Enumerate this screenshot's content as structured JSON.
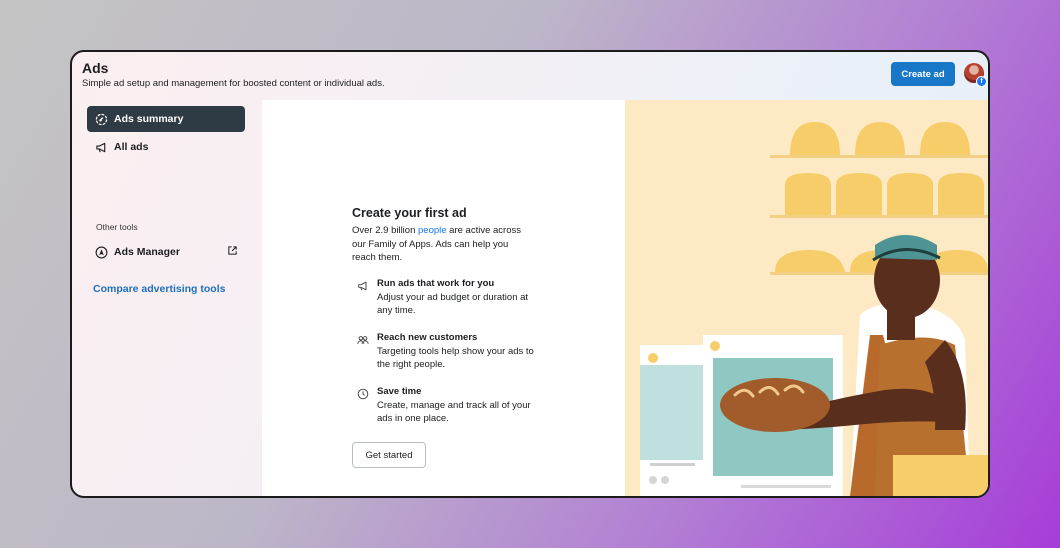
{
  "header": {
    "title": "Ads",
    "subtitle": "Simple ad setup and management for boosted content or individual ads.",
    "create_button": "Create ad"
  },
  "sidebar": {
    "items": [
      {
        "label": "Ads summary",
        "icon": "gauge-icon",
        "active": true
      },
      {
        "label": "All ads",
        "icon": "megaphone-icon",
        "active": false
      }
    ],
    "other_tools_label": "Other tools",
    "tools": [
      {
        "label": "Ads Manager",
        "icon": "navigation-arrow-icon",
        "external_icon": "external-link-icon"
      }
    ],
    "compare_link": "Compare advertising tools"
  },
  "main": {
    "title": "Create your first ad",
    "desc_before": "Over 2.9 billion ",
    "desc_link": "people",
    "desc_after": " are active across our Family of Apps. Ads can help you reach them.",
    "features": [
      {
        "title": "Run ads that work for you",
        "desc": "Adjust your ad budget or duration at any time.",
        "icon": "megaphone-icon"
      },
      {
        "title": "Reach new customers",
        "desc": "Targeting tools help show your ads to the right people.",
        "icon": "people-icon"
      },
      {
        "title": "Save time",
        "desc": "Create, manage and track all of your ads in one place.",
        "icon": "clock-icon"
      }
    ],
    "cta": "Get started"
  },
  "colors": {
    "primary": "#1877c6",
    "active_nav": "#2f3b44",
    "link": "#1f6fbf",
    "hero_bg": "#fde9c3"
  }
}
